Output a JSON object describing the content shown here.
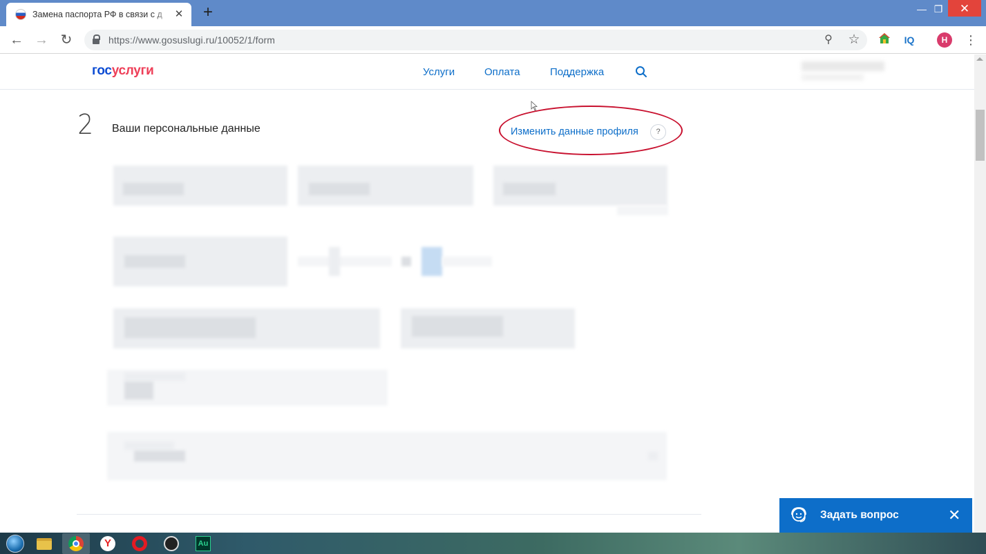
{
  "browser": {
    "tab_title": "Замена паспорта РФ в связи с д",
    "tab_close": "✕",
    "new_tab": "+",
    "url": "https://www.gosuslugi.ru/10052/1/form",
    "back": "←",
    "forward": "→",
    "reload": "↻",
    "zoom_icon": "⚲",
    "star_icon": "☆",
    "ext_iq": "IQ",
    "avatar_letter": "Н",
    "menu": "⋮",
    "win_min": "—",
    "win_max": "❐",
    "win_close": "✕"
  },
  "site": {
    "logo_part1": "гос",
    "logo_part2": "услуги",
    "nav": [
      "Услуги",
      "Оплата",
      "Поддержка"
    ]
  },
  "section": {
    "number": "2",
    "title": "Ваши персональные данные",
    "edit_link": "Изменить данные профиля",
    "help": "?"
  },
  "chat": {
    "label": "Задать вопрос",
    "close": "✕"
  },
  "taskbar": {
    "au_label": "Au",
    "yandex_label": "Y"
  },
  "colors": {
    "accent": "#0d6ec9",
    "logo_blue": "#0d4cd3",
    "logo_red": "#ee3f58",
    "annotation": "#c8102e"
  }
}
